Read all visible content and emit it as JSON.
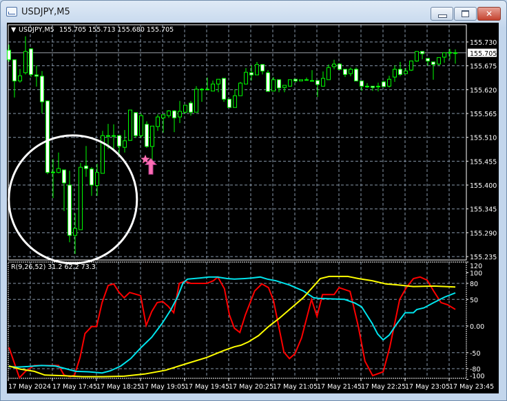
{
  "window": {
    "title": "USDJPY,M5",
    "buttons": {
      "minimize": "minimize",
      "maximize": "maximize",
      "close": "close"
    }
  },
  "chart": {
    "symbol": "USDJPY,M5",
    "ohlc": "155.705 155.713 155.680 155.705",
    "current_price": "155.705",
    "price_labels": [
      "155.730",
      "155.675",
      "155.620",
      "155.565",
      "155.510",
      "155.455",
      "155.400",
      "155.345",
      "155.290",
      "155.235"
    ],
    "time_labels": [
      "17 May 2024",
      "17 May 17:45",
      "17 May 18:25",
      "17 May 19:05",
      "17 May 19:45",
      "17 May 20:25",
      "17 May 21:05",
      "17 May 21:45",
      "17 May 22:25",
      "17 May 23:05",
      "17 May 23:45"
    ],
    "colors": {
      "candle": "#00ff00",
      "bear_body": "#ffffff",
      "bull_body": "#000000",
      "grid": "#8797aa",
      "marker": "#ff6eb4",
      "annotation": "#ffffff"
    },
    "candles": [
      [
        155.711,
        155.724,
        155.684,
        155.689
      ],
      [
        155.689,
        155.69,
        155.602,
        155.64
      ],
      [
        155.64,
        155.668,
        155.636,
        155.652
      ],
      [
        155.659,
        155.743,
        155.655,
        155.708
      ],
      [
        155.714,
        155.716,
        155.649,
        155.655
      ],
      [
        155.654,
        155.676,
        155.627,
        155.651
      ],
      [
        155.651,
        155.663,
        155.565,
        155.592
      ],
      [
        155.594,
        155.595,
        155.425,
        155.429
      ],
      [
        155.43,
        155.46,
        155.37,
        155.43
      ],
      [
        155.429,
        155.475,
        155.427,
        155.438
      ],
      [
        155.435,
        155.435,
        155.34,
        155.405
      ],
      [
        155.4,
        155.433,
        155.268,
        155.284
      ],
      [
        155.284,
        155.335,
        155.241,
        155.3
      ],
      [
        155.297,
        155.451,
        155.297,
        155.441
      ],
      [
        155.444,
        155.49,
        155.419,
        155.438
      ],
      [
        155.437,
        155.441,
        155.375,
        155.4
      ],
      [
        155.399,
        155.449,
        155.375,
        155.429
      ],
      [
        155.427,
        155.525,
        155.427,
        155.514
      ],
      [
        155.514,
        155.541,
        155.483,
        155.514
      ],
      [
        155.514,
        155.54,
        155.479,
        155.514
      ],
      [
        155.514,
        155.516,
        155.468,
        155.49
      ],
      [
        155.487,
        155.527,
        155.475,
        155.502
      ],
      [
        155.503,
        155.573,
        155.502,
        155.573
      ],
      [
        155.567,
        155.567,
        155.509,
        155.514
      ],
      [
        155.514,
        155.565,
        155.509,
        155.56
      ],
      [
        155.54,
        155.547,
        155.486,
        155.489
      ],
      [
        155.489,
        155.536,
        155.457,
        155.536
      ],
      [
        155.535,
        155.563,
        155.525,
        155.557
      ],
      [
        155.555,
        155.563,
        155.521,
        155.562
      ],
      [
        155.56,
        155.573,
        155.555,
        155.571
      ],
      [
        155.571,
        155.573,
        155.522,
        155.555
      ],
      [
        155.557,
        155.594,
        155.543,
        155.57
      ],
      [
        155.568,
        155.584,
        155.565,
        155.584
      ],
      [
        155.589,
        155.594,
        155.56,
        155.568
      ],
      [
        155.568,
        155.628,
        155.568,
        155.621
      ],
      [
        155.621,
        155.624,
        155.592,
        155.621
      ],
      [
        155.621,
        155.648,
        155.621,
        155.621
      ],
      [
        155.617,
        155.641,
        155.617,
        155.633
      ],
      [
        155.633,
        155.644,
        155.614,
        155.644
      ],
      [
        155.646,
        155.646,
        155.592,
        155.598
      ],
      [
        155.598,
        155.598,
        155.579,
        155.579
      ],
      [
        155.579,
        155.621,
        155.579,
        155.606
      ],
      [
        155.606,
        155.638,
        155.606,
        155.635
      ],
      [
        155.633,
        155.67,
        155.632,
        155.66
      ],
      [
        155.659,
        155.676,
        155.641,
        155.654
      ],
      [
        155.654,
        155.684,
        155.654,
        155.678
      ],
      [
        155.678,
        155.678,
        155.655,
        155.663
      ],
      [
        155.659,
        155.665,
        155.616,
        155.616
      ],
      [
        155.617,
        155.649,
        155.617,
        155.643
      ],
      [
        155.643,
        155.643,
        155.614,
        155.624
      ],
      [
        155.625,
        155.63,
        155.614,
        155.63
      ],
      [
        155.628,
        155.643,
        155.627,
        155.643
      ],
      [
        155.644,
        155.644,
        155.636,
        155.64
      ],
      [
        155.64,
        155.643,
        155.64,
        155.643
      ],
      [
        155.643,
        155.648,
        155.643,
        155.643
      ],
      [
        155.641,
        155.665,
        155.641,
        155.641
      ],
      [
        155.641,
        155.641,
        155.603,
        155.632
      ],
      [
        155.628,
        155.662,
        155.628,
        155.646
      ],
      [
        155.643,
        155.678,
        155.643,
        155.671
      ],
      [
        155.673,
        155.689,
        155.667,
        155.679
      ],
      [
        155.679,
        155.681,
        155.665,
        155.667
      ],
      [
        155.667,
        155.667,
        155.649,
        155.655
      ],
      [
        155.657,
        155.671,
        155.651,
        155.667
      ],
      [
        155.667,
        155.671,
        155.64,
        155.64
      ],
      [
        155.64,
        155.64,
        155.617,
        155.628
      ],
      [
        155.628,
        155.635,
        155.624,
        155.628
      ],
      [
        155.628,
        155.628,
        155.617,
        155.625
      ],
      [
        155.628,
        155.636,
        155.616,
        155.628
      ],
      [
        155.638,
        155.64,
        155.627,
        155.627
      ],
      [
        155.628,
        155.652,
        155.625,
        155.644
      ],
      [
        155.649,
        155.676,
        155.638,
        155.667
      ],
      [
        155.667,
        155.684,
        155.651,
        155.655
      ],
      [
        155.657,
        155.67,
        155.657,
        155.663
      ],
      [
        155.665,
        155.687,
        155.663,
        155.686
      ],
      [
        155.686,
        155.709,
        155.684,
        155.708
      ],
      [
        155.708,
        155.708,
        155.69,
        155.703
      ],
      [
        155.692,
        155.692,
        155.675,
        155.686
      ],
      [
        155.684,
        155.684,
        155.643,
        155.678
      ],
      [
        155.679,
        155.695,
        155.676,
        155.694
      ],
      [
        155.695,
        155.705,
        155.682,
        155.705
      ],
      [
        155.706,
        155.714,
        155.69,
        155.706
      ],
      [
        155.705,
        155.713,
        155.68,
        155.705
      ]
    ],
    "markers": {
      "star": {
        "bar": 25,
        "price": 155.459
      },
      "up_arrow": {
        "bar": 26,
        "price": 155.447
      }
    },
    "circle_annotation": {
      "center_bar": 11.6,
      "center_price": 155.367
    }
  },
  "indicator": {
    "label": "R(9,26,52) 31.2 62.2 73.3",
    "scale_labels": [
      "120",
      "100",
      "80",
      "50",
      "0.00",
      "-50",
      "-80",
      "-100"
    ],
    "grid_levels": [
      80,
      50,
      0,
      -50,
      -80
    ],
    "series": [
      {
        "name": "fast",
        "color": "#ff0000",
        "points": [
          [
            0,
            -40
          ],
          [
            1.9,
            -97
          ],
          [
            3,
            -85
          ],
          [
            4.6,
            -74
          ],
          [
            9,
            -74
          ],
          [
            10,
            -92
          ],
          [
            11.1,
            -95
          ],
          [
            11.9,
            -92
          ],
          [
            12.9,
            -59
          ],
          [
            13.8,
            -14
          ],
          [
            15,
            -1
          ],
          [
            15.9,
            -1
          ],
          [
            16.9,
            44
          ],
          [
            18,
            76
          ],
          [
            19,
            79
          ],
          [
            20,
            63
          ],
          [
            20.9,
            53
          ],
          [
            21.9,
            63
          ],
          [
            23.9,
            57
          ],
          [
            24.9,
            1
          ],
          [
            25.9,
            27
          ],
          [
            26.9,
            44
          ],
          [
            27.9,
            46
          ],
          [
            28.9,
            37
          ],
          [
            29.9,
            25
          ],
          [
            30.9,
            80
          ],
          [
            31.9,
            84
          ],
          [
            33,
            80
          ],
          [
            35.9,
            80
          ],
          [
            37.1,
            85
          ],
          [
            37.9,
            92
          ],
          [
            39.1,
            70
          ],
          [
            40,
            21
          ],
          [
            40.9,
            -4
          ],
          [
            41.9,
            -12
          ],
          [
            42.9,
            21
          ],
          [
            44.6,
            66
          ],
          [
            45.9,
            79
          ],
          [
            47.1,
            72
          ],
          [
            48,
            48
          ],
          [
            49.9,
            -49
          ],
          [
            50.9,
            -61
          ],
          [
            51.9,
            -52
          ],
          [
            53.1,
            -22
          ],
          [
            54.9,
            50
          ],
          [
            55.9,
            18
          ],
          [
            56.9,
            59
          ],
          [
            59,
            59
          ],
          [
            59.9,
            72
          ],
          [
            61.9,
            65
          ],
          [
            63.4,
            -1
          ],
          [
            64.6,
            -66
          ],
          [
            66,
            -93
          ],
          [
            67.9,
            -86
          ],
          [
            69.1,
            -40
          ],
          [
            70.9,
            50
          ],
          [
            72.1,
            72
          ],
          [
            73.4,
            89
          ],
          [
            74.6,
            92
          ],
          [
            75.9,
            86
          ],
          [
            77.1,
            65
          ],
          [
            78.4,
            44
          ],
          [
            79.6,
            40
          ],
          [
            81,
            31.2
          ]
        ]
      },
      {
        "name": "medium",
        "color": "#00e5ee",
        "points": [
          [
            0,
            -76
          ],
          [
            1.5,
            -77
          ],
          [
            3.4,
            -76
          ],
          [
            5.9,
            -74
          ],
          [
            8.4,
            -75
          ],
          [
            10.3,
            -80
          ],
          [
            12.1,
            -85
          ],
          [
            14.6,
            -86
          ],
          [
            16.9,
            -88
          ],
          [
            18.4,
            -84
          ],
          [
            20.3,
            -75
          ],
          [
            22.1,
            -61
          ],
          [
            24,
            -40
          ],
          [
            25.9,
            -21
          ],
          [
            27.8,
            5
          ],
          [
            29.4,
            31
          ],
          [
            30.6,
            55
          ],
          [
            31.6,
            81
          ],
          [
            32.4,
            88
          ],
          [
            34.6,
            90
          ],
          [
            36.3,
            92
          ],
          [
            37.8,
            92
          ],
          [
            39.6,
            89
          ],
          [
            40.9,
            88
          ],
          [
            42.8,
            89
          ],
          [
            44,
            90
          ],
          [
            45.6,
            92
          ],
          [
            46.9,
            88
          ],
          [
            48.4,
            85
          ],
          [
            50.9,
            77
          ],
          [
            53.4,
            66
          ],
          [
            55.3,
            53
          ],
          [
            56.1,
            52
          ],
          [
            60.9,
            50
          ],
          [
            62.8,
            43
          ],
          [
            64,
            36
          ],
          [
            65.9,
            5
          ],
          [
            66.9,
            -15
          ],
          [
            67.9,
            -26
          ],
          [
            69,
            -17
          ],
          [
            70.3,
            3
          ],
          [
            71.9,
            25
          ],
          [
            73.4,
            25
          ],
          [
            74,
            31
          ],
          [
            75.3,
            34
          ],
          [
            77.1,
            44
          ],
          [
            79,
            54
          ],
          [
            81,
            62.2
          ]
        ]
      },
      {
        "name": "slow",
        "color": "#ffff00",
        "points": [
          [
            0,
            -75
          ],
          [
            2.1,
            -81
          ],
          [
            4.6,
            -85
          ],
          [
            6.5,
            -92
          ],
          [
            9.6,
            -93
          ],
          [
            13.4,
            -95
          ],
          [
            17.1,
            -95
          ],
          [
            20.9,
            -94
          ],
          [
            24.6,
            -90
          ],
          [
            28.4,
            -83
          ],
          [
            32.1,
            -71
          ],
          [
            35.9,
            -59
          ],
          [
            39,
            -46
          ],
          [
            40.9,
            -39
          ],
          [
            42.1,
            -36
          ],
          [
            43.4,
            -30
          ],
          [
            45.3,
            -18
          ],
          [
            47.1,
            -1
          ],
          [
            49,
            14
          ],
          [
            50.9,
            31
          ],
          [
            53.4,
            53
          ],
          [
            55.3,
            75
          ],
          [
            56.5,
            89
          ],
          [
            58.1,
            93
          ],
          [
            61.5,
            93
          ],
          [
            63.4,
            89
          ],
          [
            65.9,
            85
          ],
          [
            68.4,
            79
          ],
          [
            70.6,
            77
          ],
          [
            73.4,
            74
          ],
          [
            77.1,
            75
          ],
          [
            81,
            73.3
          ]
        ]
      }
    ]
  }
}
